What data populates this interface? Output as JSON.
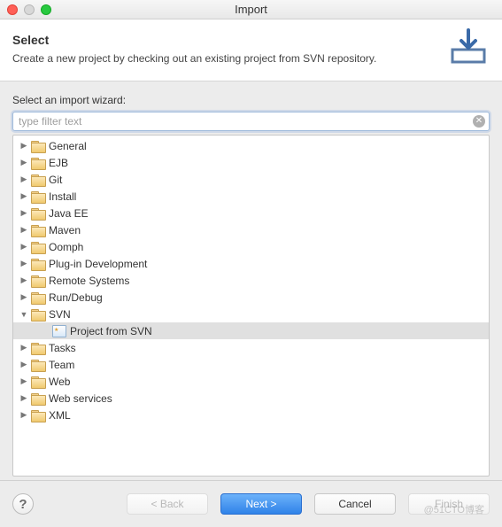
{
  "window": {
    "title": "Import"
  },
  "header": {
    "title": "Select",
    "description": "Create a new project by checking out an existing project from SVN repository."
  },
  "body": {
    "wizard_label": "Select an import wizard:",
    "filter_value": "type filter text"
  },
  "tree": {
    "items": [
      {
        "label": "General",
        "expanded": false,
        "kind": "folder"
      },
      {
        "label": "EJB",
        "expanded": false,
        "kind": "folder"
      },
      {
        "label": "Git",
        "expanded": false,
        "kind": "folder"
      },
      {
        "label": "Install",
        "expanded": false,
        "kind": "folder"
      },
      {
        "label": "Java EE",
        "expanded": false,
        "kind": "folder"
      },
      {
        "label": "Maven",
        "expanded": false,
        "kind": "folder"
      },
      {
        "label": "Oomph",
        "expanded": false,
        "kind": "folder"
      },
      {
        "label": "Plug-in Development",
        "expanded": false,
        "kind": "folder"
      },
      {
        "label": "Remote Systems",
        "expanded": false,
        "kind": "folder"
      },
      {
        "label": "Run/Debug",
        "expanded": false,
        "kind": "folder"
      },
      {
        "label": "SVN",
        "expanded": true,
        "kind": "folder",
        "children": [
          {
            "label": "Project from SVN",
            "kind": "project",
            "selected": true
          }
        ]
      },
      {
        "label": "Tasks",
        "expanded": false,
        "kind": "folder"
      },
      {
        "label": "Team",
        "expanded": false,
        "kind": "folder"
      },
      {
        "label": "Web",
        "expanded": false,
        "kind": "folder"
      },
      {
        "label": "Web services",
        "expanded": false,
        "kind": "folder"
      },
      {
        "label": "XML",
        "expanded": false,
        "kind": "folder"
      }
    ]
  },
  "footer": {
    "back": "< Back",
    "next": "Next >",
    "cancel": "Cancel",
    "finish": "Finish"
  },
  "watermark": "@51CTO博客"
}
